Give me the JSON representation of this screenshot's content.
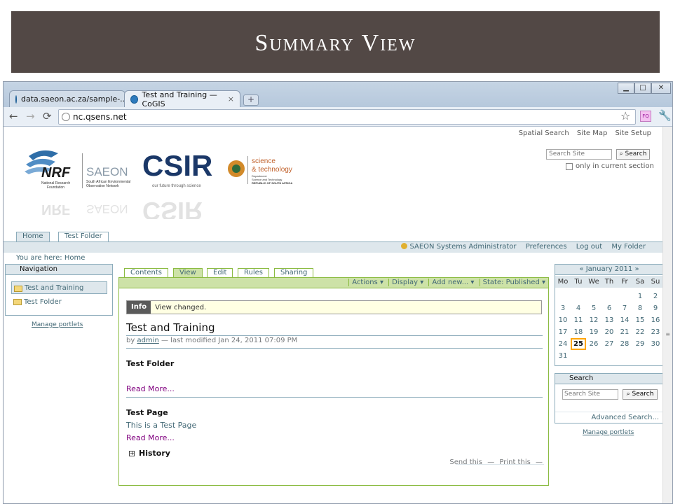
{
  "slide": {
    "title": "Summary View"
  },
  "browser": {
    "tabs": [
      {
        "label": "data.saeon.ac.za/sample-...",
        "close": "×"
      },
      {
        "label": "Test and Training — CoGIS",
        "close": "×"
      }
    ],
    "new_tab": "+",
    "window_controls": {
      "minimize": "▁",
      "maximize": "□",
      "close": "✕"
    },
    "nav": {
      "back": "←",
      "forward": "→",
      "reload": "⟳"
    },
    "url": "nc.qsens.net",
    "star": "☆",
    "extension": "FQ",
    "wrench": "🔧"
  },
  "site": {
    "actions": [
      "Spatial Search",
      "Site Map",
      "Site Setup"
    ],
    "search": {
      "placeholder": "Search Site",
      "button": "Search",
      "current_section": "only in current section"
    },
    "logos": {
      "nrf": "NRF",
      "nrf_sub1": "National Research",
      "nrf_sub2": "Foundation",
      "saeon": "SAEON",
      "saeon_sub1": "South African Environmental",
      "saeon_sub2": "Observation Network",
      "csir": "CSIR",
      "csir_tagline": "our future through science",
      "dst1": "science",
      "dst2": "& technology",
      "dst_sub1": "Department:",
      "dst_sub2": "Science and Technology",
      "dst_sub3": "REPUBLIC OF SOUTH AFRICA"
    },
    "portal_tabs": [
      "Home",
      "Test Folder"
    ],
    "personal_bar": [
      "SAEON Systems Administrator",
      "Preferences",
      "Log out",
      "My Folder"
    ],
    "breadcrumb": {
      "prefix": "You are here:",
      "current": "Home"
    }
  },
  "navigation": {
    "header": "Navigation",
    "items": [
      "Test and Training",
      "Test Folder"
    ],
    "manage": "Manage portlets"
  },
  "content": {
    "tabs": [
      "Contents",
      "View",
      "Edit",
      "Rules",
      "Sharing"
    ],
    "actions": [
      "Actions ▾",
      "Display ▾",
      "Add new... ▾",
      "State: Published ▾"
    ],
    "info": {
      "label": "Info",
      "text": "View changed."
    },
    "title": "Test and Training",
    "byline": {
      "prefix": "by",
      "author": "admin",
      "suffix": "— last modified Jan 24, 2011 07:09 PM"
    },
    "items": [
      {
        "title": "Test Folder",
        "description": "",
        "read_more": "Read More..."
      },
      {
        "title": "Test Page",
        "description": "This is a Test Page",
        "read_more": "Read More..."
      }
    ],
    "history": "History",
    "history_toggle": "+",
    "doc_actions": [
      "Send this",
      "Print this"
    ]
  },
  "calendar": {
    "prev": "«",
    "month": "January 2011",
    "next": "»",
    "days": [
      "Mo",
      "Tu",
      "We",
      "Th",
      "Fr",
      "Sa",
      "Su"
    ],
    "weeks": [
      [
        "",
        "",
        "",
        "",
        "",
        "1",
        "2"
      ],
      [
        "3",
        "4",
        "5",
        "6",
        "7",
        "8",
        "9"
      ],
      [
        "10",
        "11",
        "12",
        "13",
        "14",
        "15",
        "16"
      ],
      [
        "17",
        "18",
        "19",
        "20",
        "21",
        "22",
        "23"
      ],
      [
        "24",
        "25",
        "26",
        "27",
        "28",
        "29",
        "30"
      ],
      [
        "31",
        "",
        "",
        "",
        "",
        "",
        ""
      ]
    ],
    "today": "25"
  },
  "search_portlet": {
    "header": "Search",
    "placeholder": "Search Site",
    "button": "Search",
    "advanced": "Advanced Search...",
    "manage": "Manage portlets"
  }
}
